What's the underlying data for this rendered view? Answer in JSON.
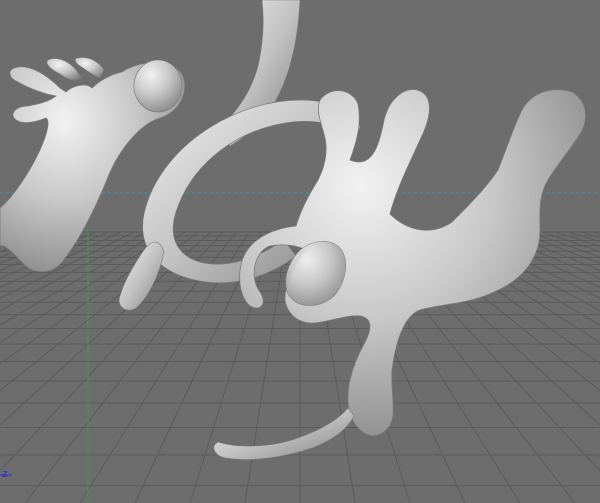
{
  "viewport": {
    "axis_indicator": {
      "z_label": "z"
    },
    "colors": {
      "background": "#6d6d6d",
      "grid_line": "#5b5b5b",
      "grid_major": "#4c4c4c",
      "horizon_line": "#3a8fb6",
      "y_axis": "#2fa830",
      "z_axis": "#2b2fd6",
      "mesh_light": "#e2e2e2",
      "mesh_mid": "#bdbdbd",
      "mesh_dark": "#868686"
    }
  }
}
